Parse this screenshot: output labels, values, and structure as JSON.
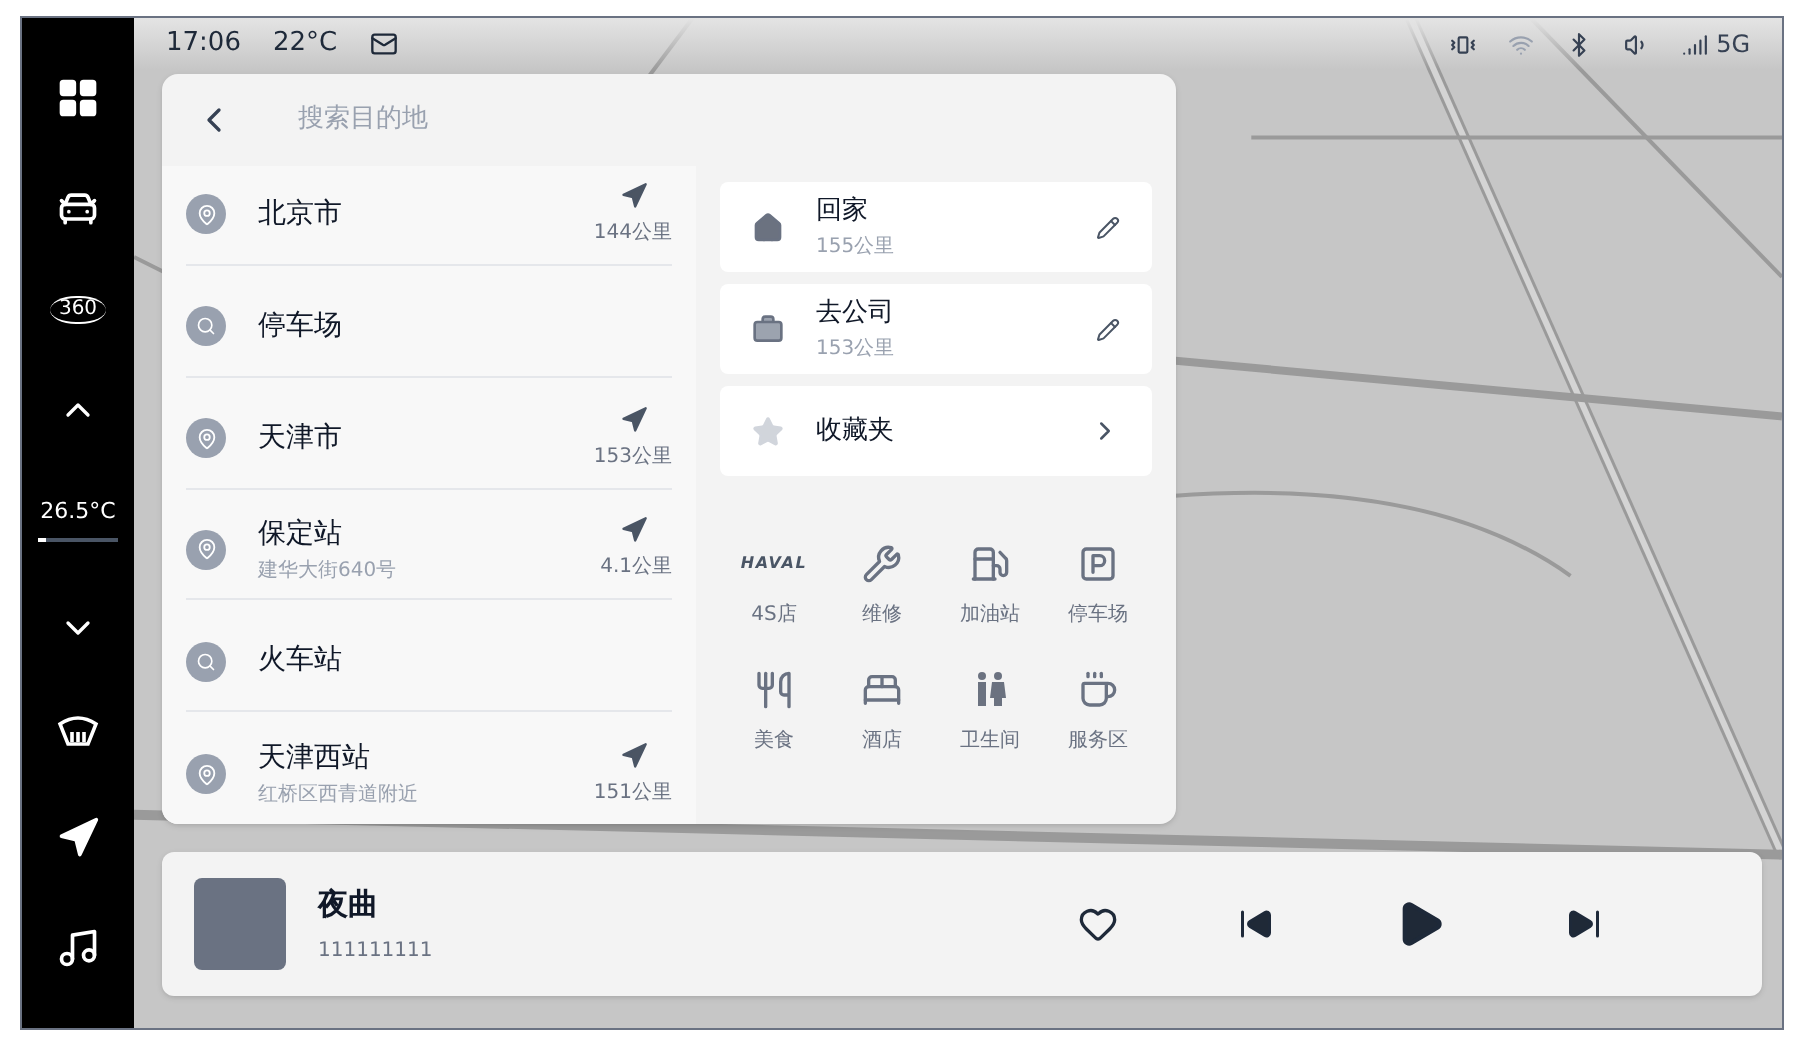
{
  "status_bar": {
    "time": "17:06",
    "temperature": "22°C",
    "network": "5G"
  },
  "sidebar": {
    "items": [
      {
        "kind": "apps"
      },
      {
        "kind": "car"
      },
      {
        "kind": "camera360",
        "label": "360"
      },
      {
        "kind": "up"
      },
      {
        "kind": "climate",
        "label": "26.5°C",
        "level": 0.1
      },
      {
        "kind": "down"
      },
      {
        "kind": "defrost"
      },
      {
        "kind": "navigation"
      },
      {
        "kind": "music"
      }
    ]
  },
  "search": {
    "placeholder": "搜索目的地"
  },
  "results": [
    {
      "kind": "place",
      "name": "北京市",
      "distance": "144公里"
    },
    {
      "kind": "search",
      "name": "停车场"
    },
    {
      "kind": "place",
      "name": "天津市",
      "distance": "153公里"
    },
    {
      "kind": "place",
      "name": "保定站",
      "address": "建华大街640号",
      "distance": "4.1公里"
    },
    {
      "kind": "search",
      "name": "火车站"
    },
    {
      "kind": "place",
      "name": "天津西站",
      "address": "红桥区西青道附近",
      "distance": "151公里"
    }
  ],
  "shortcuts": [
    {
      "kind": "home",
      "title": "回家",
      "distance": "155公里"
    },
    {
      "kind": "work",
      "title": "去公司",
      "distance": "153公里"
    },
    {
      "kind": "favorites",
      "title": "收藏夹"
    }
  ],
  "categories": [
    {
      "kind": "brand",
      "logo": "HAVAL",
      "label": "4S店"
    },
    {
      "kind": "repair",
      "label": "维修"
    },
    {
      "kind": "fuel",
      "label": "加油站"
    },
    {
      "kind": "parking",
      "label": "停车场"
    },
    {
      "kind": "food",
      "label": "美食"
    },
    {
      "kind": "hotel",
      "label": "酒店"
    },
    {
      "kind": "toilet",
      "label": "卫生间"
    },
    {
      "kind": "service",
      "label": "服务区"
    }
  ],
  "player": {
    "title": "夜曲",
    "artist": "111111111",
    "liked": false
  }
}
